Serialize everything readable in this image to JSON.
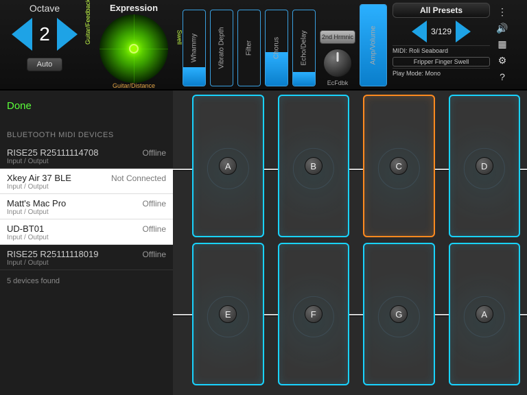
{
  "octave": {
    "title": "Octave",
    "value": "2",
    "auto": "Auto"
  },
  "expression": {
    "title": "Expression",
    "axis_left": "Guitar/Feedback",
    "axis_right": "Swell",
    "axis_bottom": "Guitar/Distance"
  },
  "sliders": [
    {
      "label": "Whammy",
      "fill": 25
    },
    {
      "label": "Vibrato Depth",
      "fill": 0
    },
    {
      "label": "Filter",
      "fill": 0
    },
    {
      "label": "Chorus",
      "fill": 45
    },
    {
      "label": "Echo/Delay",
      "fill": 18
    }
  ],
  "knob": {
    "button": "2nd Hrmnic",
    "label": "EcFdbk"
  },
  "amp": {
    "label": "Amp/Volume",
    "fill": 100
  },
  "presets": {
    "button": "All Presets",
    "index": "3/129",
    "midi": "MIDI: Roli Seaboard",
    "patch": "Fripper Finger Swell",
    "mode": "Play Mode: Mono"
  },
  "pads": {
    "row1": [
      {
        "note": "A",
        "color": "cyan"
      },
      {
        "note": "B",
        "color": "cyan"
      },
      {
        "note": "C",
        "color": "orange"
      },
      {
        "note": "D",
        "color": "cyan"
      }
    ],
    "row2": [
      {
        "note": "E",
        "color": "cyan"
      },
      {
        "note": "F",
        "color": "cyan"
      },
      {
        "note": "G",
        "color": "cyan"
      },
      {
        "note": "A",
        "color": "cyan"
      }
    ]
  },
  "bt": {
    "done": "Done",
    "header": "BLUETOOTH MIDI DEVICES",
    "devices": [
      {
        "name": "RISE25 R25111114708",
        "io": "Input / Output",
        "status": "Offline",
        "dark": true
      },
      {
        "name": "Xkey Air 37 BLE",
        "io": "Input / Output",
        "status": "Not Connected",
        "dark": false
      },
      {
        "name": "Matt's Mac Pro",
        "io": "Input / Output",
        "status": "Offline",
        "dark": false
      },
      {
        "name": "UD-BT01",
        "io": "Input / Output",
        "status": "Offline",
        "dark": false
      },
      {
        "name": "RISE25 R25111118019",
        "io": "Input / Output",
        "status": "Offline",
        "dark": true
      }
    ],
    "footer": "5 devices found"
  },
  "icons": {
    "menu": "⋮",
    "sound": "🔊",
    "device": "▦",
    "sliders": "⚙",
    "help": "?"
  }
}
